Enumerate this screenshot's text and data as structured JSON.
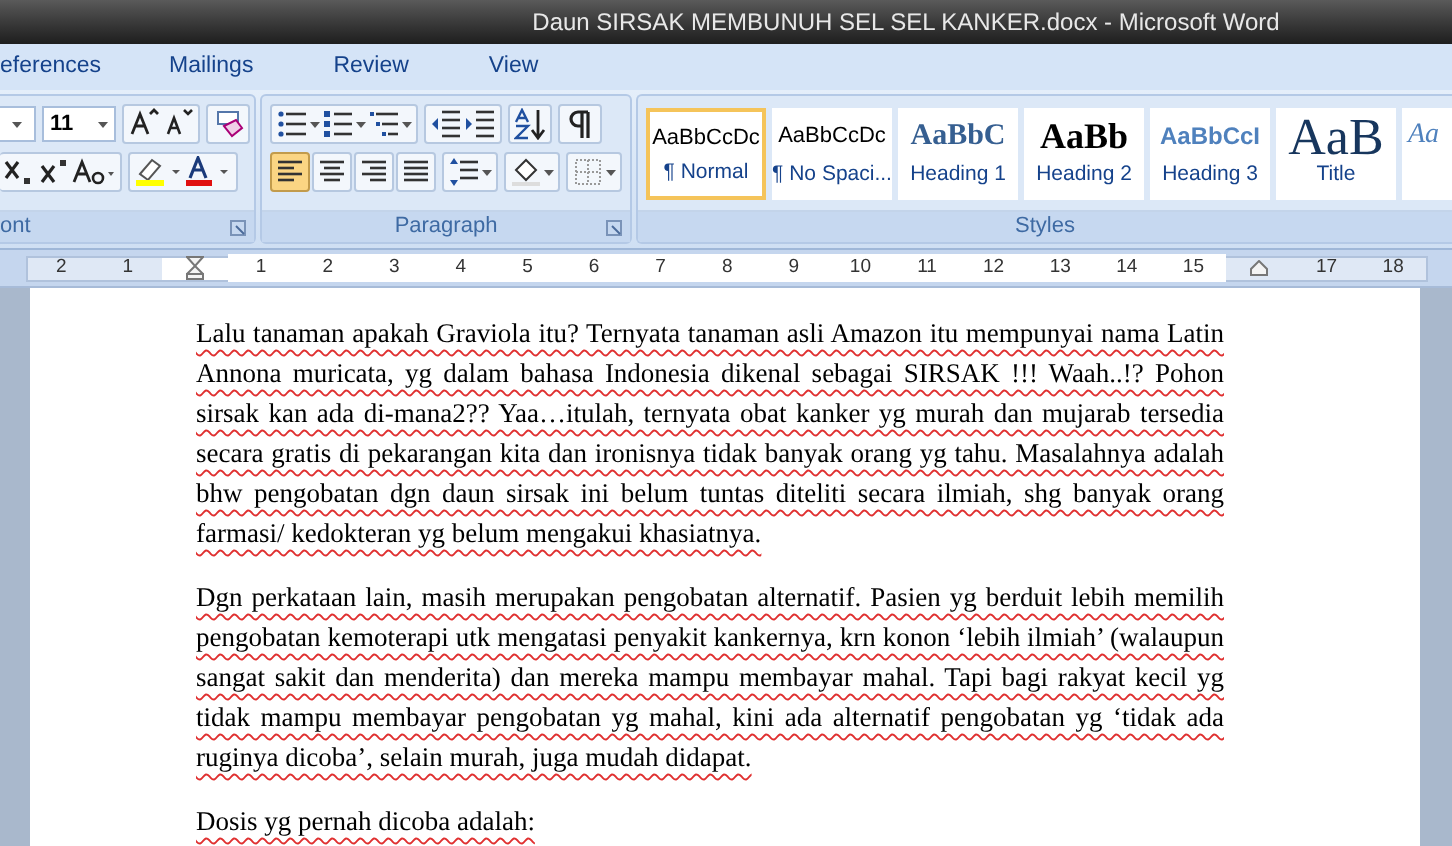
{
  "window": {
    "title": "Daun SIRSAK MEMBUNUH SEL SEL KANKER.docx - Microsoft Word"
  },
  "tabs": [
    {
      "label": "eferences"
    },
    {
      "label": "Mailings"
    },
    {
      "label": "Review"
    },
    {
      "label": "View"
    }
  ],
  "font_group": {
    "font_size": "11",
    "label": "ont"
  },
  "paragraph_group": {
    "label": "Paragraph",
    "alignment": [
      {
        "kind": "left",
        "selected": true
      },
      {
        "kind": "center",
        "selected": false
      },
      {
        "kind": "right",
        "selected": false
      },
      {
        "kind": "justify",
        "selected": false
      }
    ]
  },
  "styles_group": {
    "label": "Styles",
    "items": [
      {
        "kind": "normal",
        "preview": "AaBbCcDc",
        "name": "¶ Normal",
        "selected": true
      },
      {
        "kind": "normal",
        "preview": "AaBbCcDc",
        "name": "¶ No Spaci...",
        "selected": false
      },
      {
        "kind": "heading1",
        "preview": "AaBbC",
        "name": "Heading 1",
        "selected": false
      },
      {
        "kind": "heading2",
        "preview": "AaBb",
        "name": "Heading 2",
        "selected": false
      },
      {
        "kind": "heading3",
        "preview": "AaBbCcI",
        "name": "Heading 3",
        "selected": false
      },
      {
        "kind": "title",
        "preview": "AaB",
        "name": "Title",
        "selected": false
      },
      {
        "kind": "subtitle",
        "preview": "Aa",
        "selected": false
      }
    ]
  },
  "ruler": {
    "left_labels": [
      "2",
      "1"
    ],
    "labels": [
      "1",
      "2",
      "3",
      "4",
      "5",
      "6",
      "7",
      "8",
      "9",
      "10",
      "11",
      "12",
      "13",
      "14",
      "15"
    ],
    "right_labels": [
      "17",
      "18"
    ]
  },
  "document": {
    "paragraphs": [
      "Lalu tanaman apakah Graviola itu? Ternyata tanaman asli Amazon itu mempunyai nama Latin Annona muricata, yg dalam bahasa Indonesia dikenal sebagai SIRSAK !!! Waah..!? Pohon sirsak kan ada di-mana2?? Yaa…itulah, ternyata obat kanker yg murah dan mujarab tersedia secara gratis di pekarangan kita dan ironisnya tidak banyak orang yg tahu. Masalahnya adalah bhw pengobatan dgn daun sirsak ini belum tuntas diteliti secara ilmiah, shg banyak orang farmasi/ kedokteran yg belum mengakui khasiatnya.",
      "Dgn perkataan lain, masih merupakan pengobatan alternatif. Pasien yg berduit lebih memilih pengobatan kemoterapi utk mengatasi penyakit kankernya, krn konon ‘lebih ilmiah’ (walaupun sangat sakit dan menderita) dan mereka mampu membayar mahal. Tapi bagi rakyat kecil yg tidak mampu membayar pengobatan yg mahal, kini ada alternatif pengobatan yg ‘tidak ada ruginya dicoba’, selain murah, juga mudah didapat.",
      "Dosis yg pernah dicoba adalah:"
    ]
  }
}
